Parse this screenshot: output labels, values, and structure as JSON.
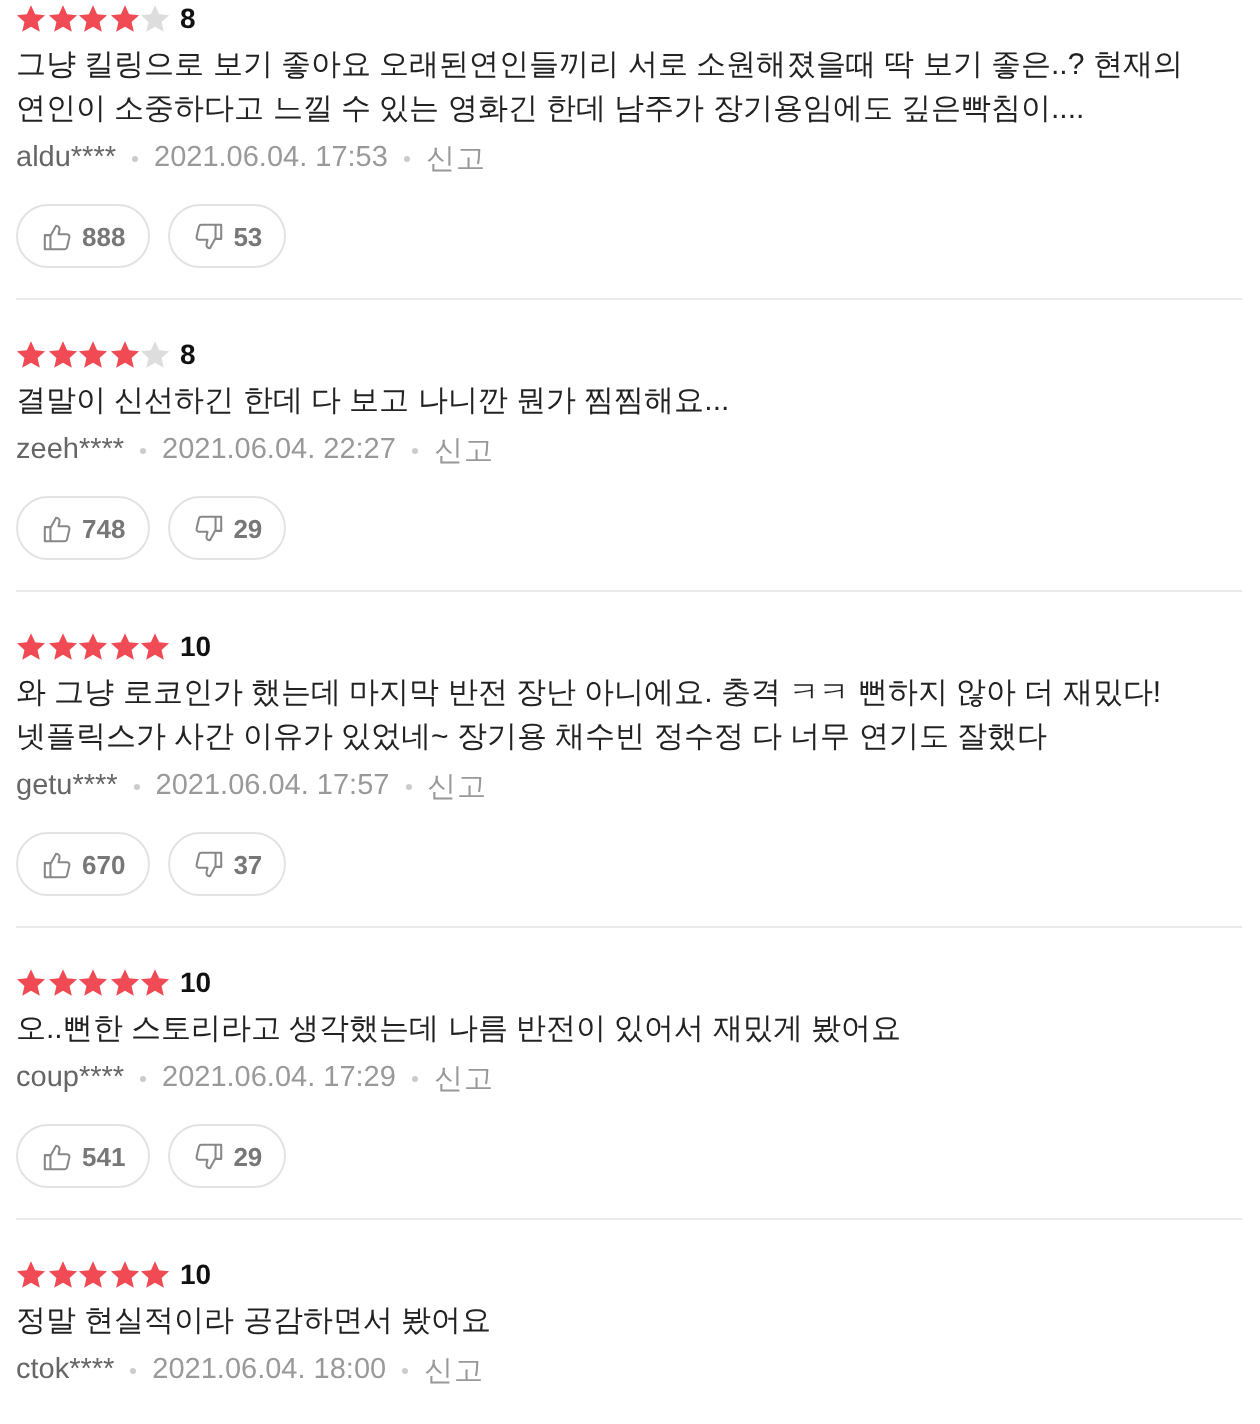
{
  "reviews": [
    {
      "stars": 4,
      "score": "8",
      "text": "그냥 킬링으로 보기 좋아요 오래된연인들끼리 서로 소원해졌을때 딱 보기 좋은..? 현재의 연인이 소중하다고 느낄 수 있는 영화긴 한데 남주가 장기용임에도 깊은빡침이....",
      "author": "aldu****",
      "date": "2021.06.04. 17:53",
      "report": "신고",
      "likes": "888",
      "dislikes": "53"
    },
    {
      "stars": 4,
      "score": "8",
      "text": "결말이 신선하긴 한데 다 보고 나니깐 뭔가 찜찜해요...",
      "author": "zeeh****",
      "date": "2021.06.04. 22:27",
      "report": "신고",
      "likes": "748",
      "dislikes": "29"
    },
    {
      "stars": 5,
      "score": "10",
      "text": "와 그냥 로코인가 했는데 마지막 반전 장난 아니에요. 충격 ㅋㅋ 뻔하지 않아 더 재밌다! 넷플릭스가 사간 이유가 있었네~ 장기용 채수빈 정수정 다 너무 연기도 잘했다",
      "author": "getu****",
      "date": "2021.06.04. 17:57",
      "report": "신고",
      "likes": "670",
      "dislikes": "37"
    },
    {
      "stars": 5,
      "score": "10",
      "text": "오..뻔한 스토리라고 생각했는데 나름 반전이 있어서 재밌게 봤어요",
      "author": "coup****",
      "date": "2021.06.04. 17:29",
      "report": "신고",
      "likes": "541",
      "dislikes": "29"
    },
    {
      "stars": 5,
      "score": "10",
      "text": "정말 현실적이라 공감하면서 봤어요",
      "author": "ctok****",
      "date": "2021.06.04. 18:00",
      "report": "신고"
    }
  ]
}
